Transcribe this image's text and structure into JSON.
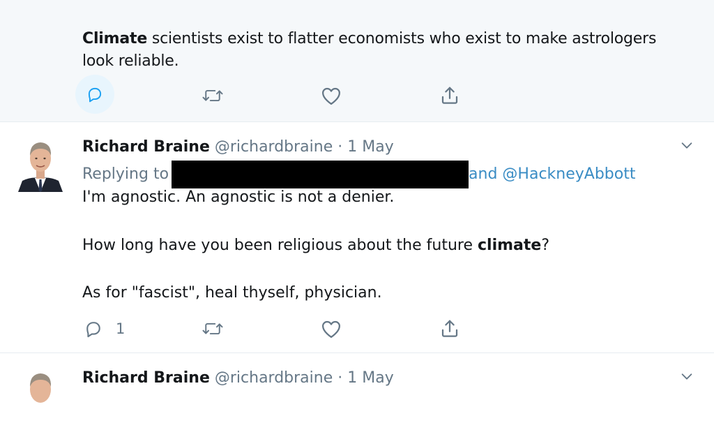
{
  "tweets": [
    {
      "text_bold": "Climate",
      "text_rest": " scientists exist to flatter economists who exist to make astrologers look reliable.",
      "actions": {
        "reply_count": "",
        "reply_highlighted": true
      }
    },
    {
      "author": {
        "name": "Richard Braine",
        "handle": "@richardbraine",
        "separator": "·",
        "date": "1 May"
      },
      "replying_to_label": "Replying to",
      "replying_to_tail": "and @HackneyAbbott",
      "lines": {
        "l1": "I'm agnostic. An agnostic is not a denier.",
        "l2_before": "How long have you been religious about the future ",
        "l2_bold": "climate",
        "l2_after": "?",
        "l3": "As for \"fascist\", heal thyself, physician."
      },
      "actions": {
        "reply_count": "1"
      }
    },
    {
      "author": {
        "name": "Richard Braine",
        "handle": "@richardbraine",
        "separator": "·",
        "date": "1 May"
      }
    }
  ],
  "colors": {
    "link": "#3a8cc4",
    "secondary_text": "#657786",
    "highlight_bg": "#f5f8fa",
    "reply_circle": "#e8f5fd"
  },
  "icons": [
    "reply-icon",
    "retweet-icon",
    "like-icon",
    "share-icon",
    "chevron-down-icon"
  ]
}
